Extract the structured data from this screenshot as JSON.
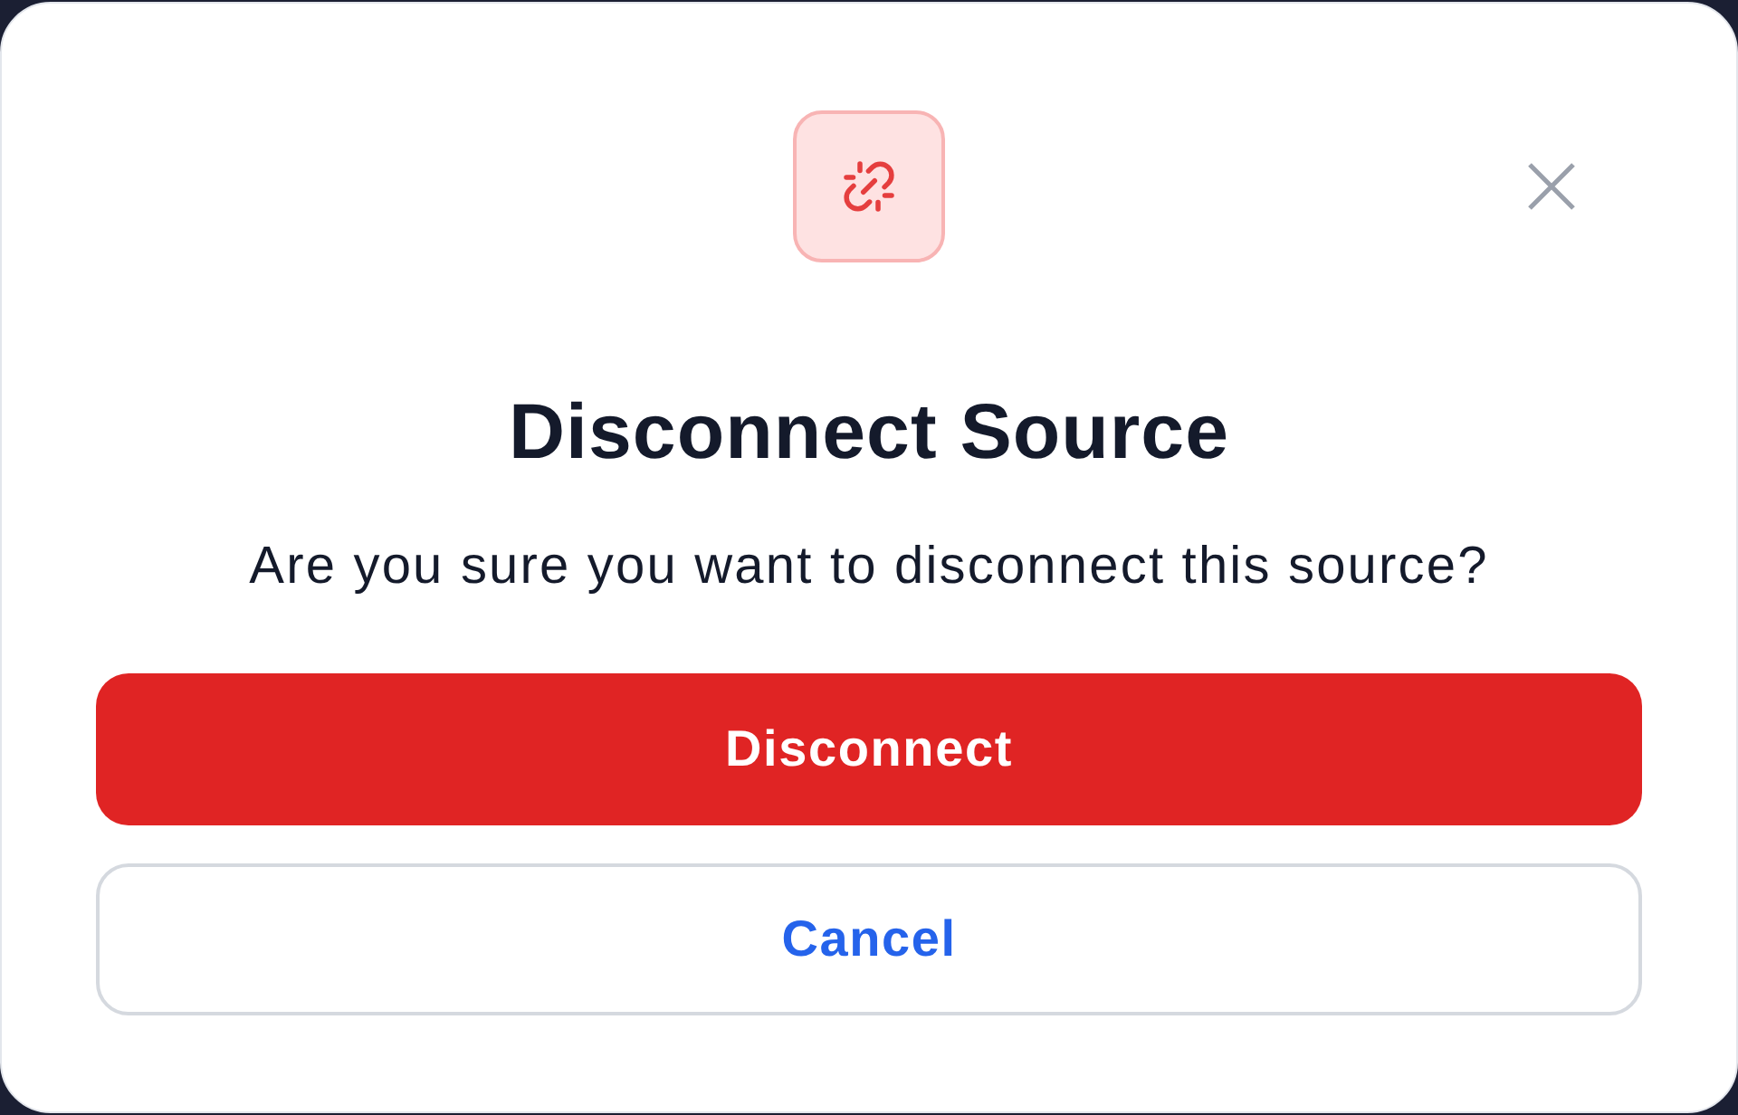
{
  "dialog": {
    "title": "Disconnect Source",
    "message": "Are you sure you want to disconnect this source?",
    "buttons": [
      {
        "label": "Disconnect",
        "kind": "danger"
      },
      {
        "label": "Cancel",
        "kind": "secondary"
      }
    ]
  }
}
